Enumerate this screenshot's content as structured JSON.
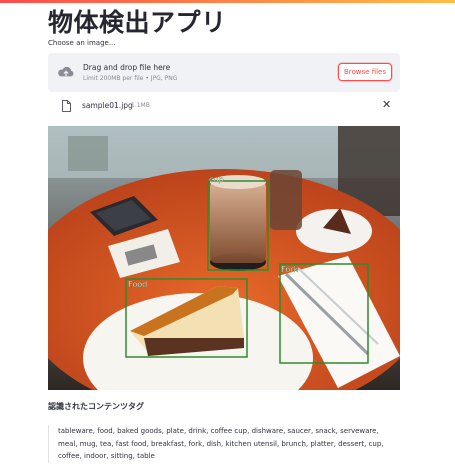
{
  "app": {
    "title": "物体検出アプリ"
  },
  "uploader": {
    "label": "Choose an image...",
    "drop_text": "Drag and drop file here",
    "limit_text": "Limit 200MB per file • JPG, PNG",
    "browse_label": "Browse files",
    "icon": "cloud-upload-icon"
  },
  "file": {
    "name": "sample01.jpg",
    "size": "1.1MB",
    "icon": "file-icon",
    "remove_icon": "close-icon"
  },
  "detections": [
    {
      "label": "cup"
    },
    {
      "label": "Food"
    },
    {
      "label": "Fork"
    }
  ],
  "tags": {
    "heading": "認識されたコンテンツタグ",
    "text": "tableware, food, baked goods, plate, drink, coffee cup, dishware, saucer, snack, serveware, meal, mug, tea, fast food, breakfast, fork, dish, kitchen utensil, brunch, platter, dessert, cup, coffee, indoor, sitting, table"
  },
  "colors": {
    "accent": "#ff4b4b",
    "box": "#2e8b2e",
    "table": "#d8571f"
  }
}
